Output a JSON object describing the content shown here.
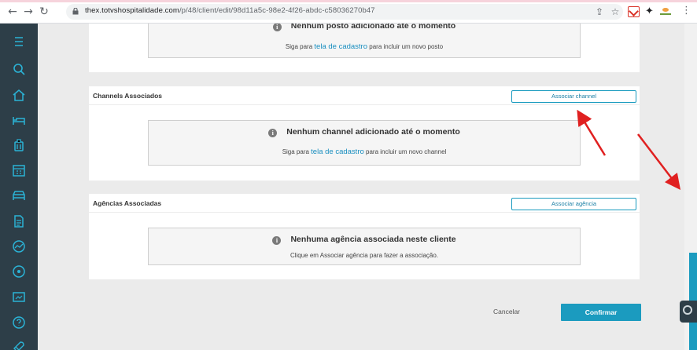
{
  "browser": {
    "url_host": "thex.totvshospitalidade.com",
    "url_path": "/p/48/client/edit/98d11a5c-98e2-4f26-abdc-c58036270b47",
    "back_icon": "arrow-left-icon",
    "forward_icon": "arrow-right-icon",
    "reload_icon": "reload-icon"
  },
  "sidebar": {
    "items": [
      {
        "icon": "menu-icon"
      },
      {
        "icon": "search-icon"
      },
      {
        "icon": "home-icon"
      },
      {
        "icon": "bed-icon"
      },
      {
        "icon": "luggage-icon"
      },
      {
        "icon": "calendar-icon"
      },
      {
        "icon": "car-icon"
      },
      {
        "icon": "document-icon"
      },
      {
        "icon": "chart-icon"
      },
      {
        "icon": "gauge-icon"
      },
      {
        "icon": "report-icon"
      },
      {
        "icon": "help-icon"
      },
      {
        "icon": "rocket-icon"
      }
    ]
  },
  "postos": {
    "empty_title": "Nenhum posto adicionado até o momento",
    "empty_sub_prefix": "Siga para",
    "empty_sub_link": "tela de cadastro",
    "empty_sub_suffix": "para incluir um novo posto"
  },
  "channels": {
    "title": "Channels Associados",
    "button": "Associar channel",
    "empty_title": "Nenhum channel adicionado até o momento",
    "empty_sub_prefix": "Siga para",
    "empty_sub_link": "tela de cadastro",
    "empty_sub_suffix": "para incluir um novo channel"
  },
  "agencias": {
    "title": "Agências Associadas",
    "button": "Associar agência",
    "empty_title": "Nenhuma agência associada neste cliente",
    "empty_sub": "Clique em Associar agência para fazer a associação."
  },
  "footer": {
    "cancel": "Cancelar",
    "confirm": "Confirmar"
  },
  "colors": {
    "accent": "#1b9bbf",
    "sidebar": "#2d3e48",
    "annotation_arrow": "#e02020"
  }
}
